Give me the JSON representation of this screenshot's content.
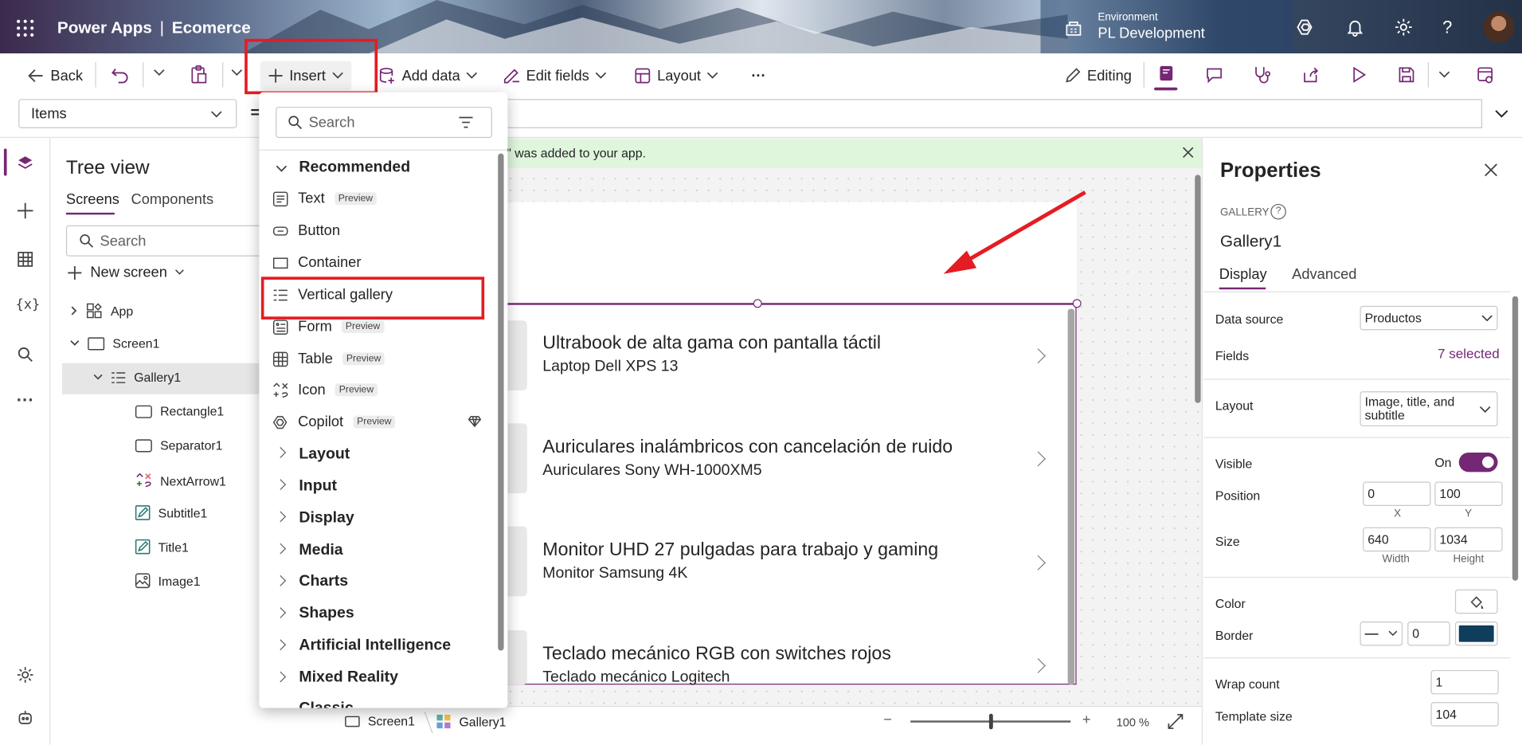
{
  "header": {
    "app_name": "Power Apps",
    "separator": "|",
    "project_name": "Ecomerce",
    "environment_label": "Environment",
    "environment_value": "PL Development"
  },
  "toolbar": {
    "back": "Back",
    "insert": "Insert",
    "add_data": "Add data",
    "edit_fields": "Edit fields",
    "layout": "Layout",
    "more": "···",
    "editing": "Editing"
  },
  "formula_bar": {
    "property": "Items",
    "equals": "="
  },
  "tree_view": {
    "title": "Tree view",
    "tabs": [
      "Screens",
      "Components"
    ],
    "search_placeholder": "Search",
    "new_screen": "New screen",
    "nodes": [
      "App",
      "Screen1",
      "Gallery1",
      "Rectangle1",
      "Separator1",
      "NextArrow1",
      "Subtitle1",
      "Title1",
      "Image1"
    ]
  },
  "insert_panel": {
    "search_placeholder": "Search",
    "recommended_header": "Recommended",
    "items": [
      {
        "label": "Text",
        "badge": "Preview",
        "icon": "text-icon"
      },
      {
        "label": "Button",
        "badge": "",
        "icon": "button-icon"
      },
      {
        "label": "Container",
        "badge": "",
        "icon": "container-icon"
      },
      {
        "label": "Vertical gallery",
        "badge": "",
        "icon": "vertical-gallery-icon"
      },
      {
        "label": "Form",
        "badge": "Preview",
        "icon": "form-icon"
      },
      {
        "label": "Table",
        "badge": "Preview",
        "icon": "table-icon"
      },
      {
        "label": "Icon",
        "badge": "Preview",
        "icon": "icon-icon"
      },
      {
        "label": "Copilot",
        "badge": "Preview",
        "icon": "copilot-icon"
      }
    ],
    "categories": [
      "Layout",
      "Input",
      "Display",
      "Media",
      "Charts",
      "Shapes",
      "Artificial Intelligence",
      "Mixed Reality",
      "Classic"
    ]
  },
  "canvas": {
    "notification": "\" was added to your app.",
    "gallery_items": [
      {
        "title": "Ultrabook de alta gama con pantalla táctil",
        "subtitle": "Laptop Dell XPS 13"
      },
      {
        "title": "Auriculares inalámbricos con cancelación de ruido",
        "subtitle": "Auriculares Sony WH-1000XM5"
      },
      {
        "title": "Monitor UHD 27 pulgadas para trabajo y gaming",
        "subtitle": "Monitor Samsung 4K"
      },
      {
        "title": "Teclado mecánico RGB con switches rojos",
        "subtitle": "Teclado mecánico Logitech"
      }
    ]
  },
  "bottom_bar": {
    "screen": "Screen1",
    "gallery": "Gallery1",
    "zoom_minus": "−",
    "zoom_plus": "+",
    "zoom": "100 %",
    "zoom_level": 0.5
  },
  "properties": {
    "title": "Properties",
    "control_type": "GALLERY",
    "control_name": "Gallery1",
    "tabs": [
      "Display",
      "Advanced"
    ],
    "data_source_label": "Data source",
    "data_source_value": "Productos",
    "fields_label": "Fields",
    "fields_value": "7 selected",
    "layout_label": "Layout",
    "layout_value": "Image, title, and subtitle",
    "visible_label": "Visible",
    "visible_value": "On",
    "position_label": "Position",
    "position_x": "0",
    "position_y": "100",
    "x_label": "X",
    "y_label": "Y",
    "size_label": "Size",
    "width": "640",
    "height": "1034",
    "width_label": "Width",
    "height_label": "Height",
    "color_label": "Color",
    "border_label": "Border",
    "border_width": "0",
    "border_color": "#0f3d5c",
    "wrap_count_label": "Wrap count",
    "wrap_count": "1",
    "template_size_label": "Template size",
    "template_size": "104"
  },
  "colors": {
    "accent": "#742774",
    "highlight": "#e51c23",
    "notification_bg": "#dff6dd"
  }
}
